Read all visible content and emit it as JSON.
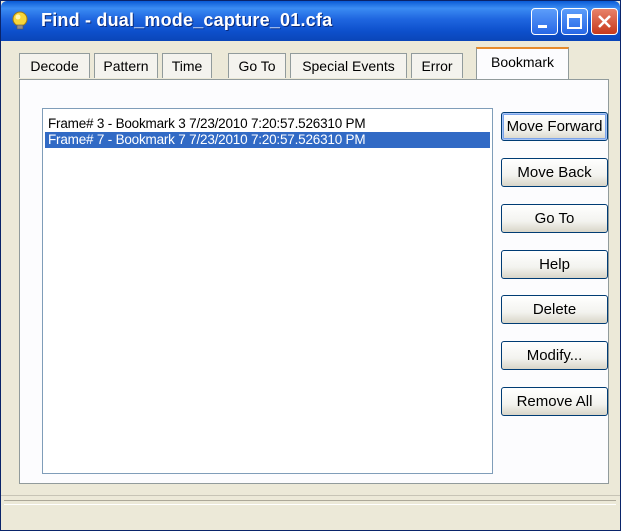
{
  "window": {
    "title": "Find - dual_mode_capture_01.cfa"
  },
  "tabs": [
    {
      "label": "Decode",
      "active": false
    },
    {
      "label": "Pattern",
      "active": false
    },
    {
      "label": "Time",
      "active": false
    },
    {
      "label": "Go To",
      "active": false
    },
    {
      "label": "Special Events",
      "active": false
    },
    {
      "label": "Error",
      "active": false
    },
    {
      "label": "Bookmark",
      "active": true
    }
  ],
  "bookmark_list": {
    "items": [
      {
        "text": "Frame# 3 - Bookmark 3  7/23/2010 7:20:57.526310 PM",
        "selected": false
      },
      {
        "text": "Frame# 7 - Bookmark 7  7/23/2010 7:20:57.526310 PM",
        "selected": true
      }
    ]
  },
  "buttons": {
    "move_forward": "Move Forward",
    "move_back": "Move Back",
    "go_to": "Go To",
    "help": "Help",
    "delete": "Delete",
    "modify": "Modify...",
    "remove_all": "Remove All"
  },
  "colors": {
    "titlebar": "#0a5bd6",
    "selection": "#316ac5",
    "active_tab_accent": "#e68b2c"
  }
}
